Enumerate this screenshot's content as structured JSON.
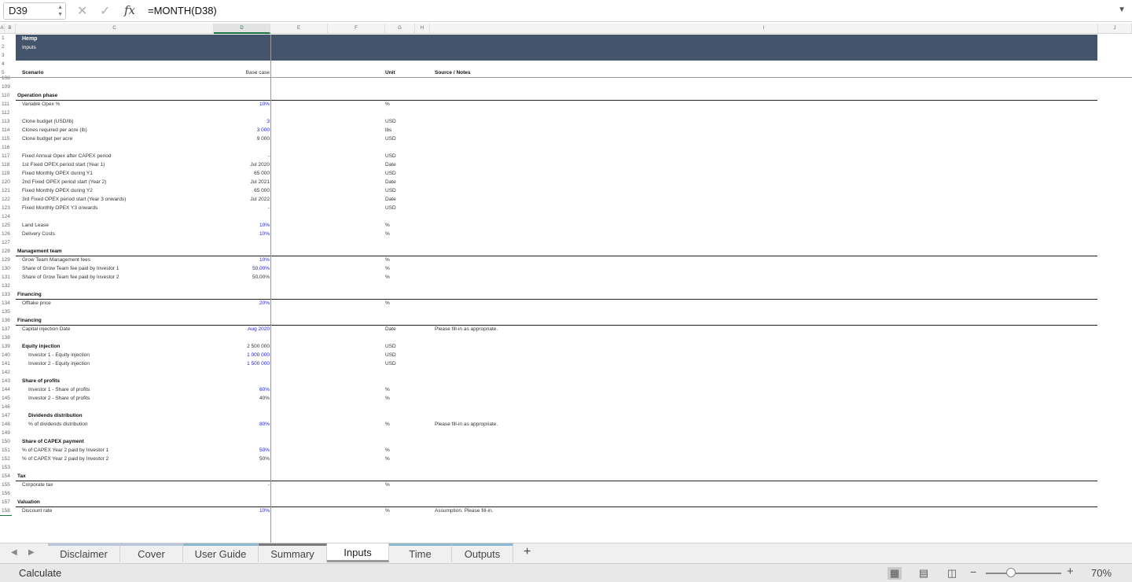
{
  "formula_bar": {
    "name_box": "D39",
    "fx_label": "fx",
    "cancel_icon": "x-icon",
    "enter_icon": "check-icon",
    "formula": "=MONTH(D38)"
  },
  "columns": [
    "A",
    "B",
    "C",
    "D",
    "E",
    "F",
    "G",
    "H",
    "I",
    "J"
  ],
  "banner": {
    "title": "Hemp",
    "subtitle": "Inputs"
  },
  "header_row": {
    "scenario": "Scenario",
    "base_case": "Base case",
    "unit": "Unit",
    "notes": "Source / Notes"
  },
  "top_row_numbers": [
    "1",
    "2",
    "3",
    "4",
    "5"
  ],
  "rows": [
    {
      "n": "108"
    },
    {
      "n": "109"
    },
    {
      "n": "110",
      "label": "Operation phase",
      "bold": true,
      "indent": 0,
      "line": true
    },
    {
      "n": "111",
      "label": "Variable Opex %",
      "value": "10%",
      "blue": true,
      "unit": "%"
    },
    {
      "n": "112"
    },
    {
      "n": "113",
      "label": "Clone budget (USD/lb)",
      "value": "3",
      "blue": true,
      "unit": "USD"
    },
    {
      "n": "114",
      "label": "Clones required per acre (lb)",
      "value": "3 000",
      "blue": true,
      "unit": "lbs"
    },
    {
      "n": "115",
      "label": "Clone budget per acre",
      "value": "9 000",
      "unit": "USD"
    },
    {
      "n": "116"
    },
    {
      "n": "117",
      "label": "Fixed Annual Opex after CAPEX period",
      "value": "-",
      "unit": "USD"
    },
    {
      "n": "118",
      "label": "1st Fixed OPEX period start (Year 1)",
      "value": "Jul 2020",
      "unit": "Date"
    },
    {
      "n": "119",
      "label": "Fixed Monthly OPEX during Y1",
      "value": "65 000",
      "unit": "USD"
    },
    {
      "n": "120",
      "label": "2nd Fixed OPEX period start (Year 2)",
      "value": "Jul 2021",
      "unit": "Date"
    },
    {
      "n": "121",
      "label": "Fixed Monthly OPEX during Y2",
      "value": "65 000",
      "unit": "USD"
    },
    {
      "n": "122",
      "label": "3rd Fixed OPEX period start (Year 3 onwards)",
      "value": "Jul 2022",
      "unit": "Date"
    },
    {
      "n": "123",
      "label": "Fixed Monthly OPEX Y3 onwards",
      "value": "-",
      "unit": "USD"
    },
    {
      "n": "124"
    },
    {
      "n": "125",
      "label": "Land Lease",
      "value": "10%",
      "blue": true,
      "unit": "%"
    },
    {
      "n": "126",
      "label": "Delivery Costs",
      "value": "10%",
      "blue": true,
      "unit": "%"
    },
    {
      "n": "127"
    },
    {
      "n": "128",
      "label": "Management team",
      "bold": true,
      "indent": 0,
      "line": true
    },
    {
      "n": "129",
      "label": "Grow Team Management fees",
      "value": "10%",
      "blue": true,
      "unit": "%"
    },
    {
      "n": "130",
      "label": "Share of Grow Team fee paid by Investor 1",
      "value": "50,00%",
      "blue": true,
      "unit": "%"
    },
    {
      "n": "131",
      "label": "Share of Grow Team fee paid by Investor 2",
      "value": "50,00%",
      "unit": "%"
    },
    {
      "n": "132"
    },
    {
      "n": "133",
      "label": "Financing",
      "bold": true,
      "indent": 0,
      "line": true
    },
    {
      "n": "134",
      "label": "Offtake price",
      "value": "20%",
      "blue": true,
      "unit": "%"
    },
    {
      "n": "135"
    },
    {
      "n": "136",
      "label": "Financing",
      "bold": true,
      "indent": 0,
      "line": true
    },
    {
      "n": "137",
      "label": "Capital injection Date",
      "value": "Aug 2020",
      "blue": true,
      "unit": "Date",
      "note": "Please fill-in as appropriate."
    },
    {
      "n": "138"
    },
    {
      "n": "139",
      "label": "Equity injection",
      "bold": true,
      "value": "2 500 000",
      "unit": "USD"
    },
    {
      "n": "140",
      "label": "Investor 1 - Equity injection",
      "indent": 2,
      "value": "1 000 000",
      "blue": true,
      "unit": "USD"
    },
    {
      "n": "141",
      "label": "Investor 2 - Equity injection",
      "indent": 2,
      "value": "1 500 000",
      "blue": true,
      "unit": "USD"
    },
    {
      "n": "142"
    },
    {
      "n": "143",
      "label": "Share of profits",
      "bold": true
    },
    {
      "n": "144",
      "label": "Investor 1 - Share of profits",
      "indent": 2,
      "value": "60%",
      "blue": true,
      "unit": "%"
    },
    {
      "n": "145",
      "label": "Investor 2 - Share of profits",
      "indent": 2,
      "value": "40%",
      "unit": "%"
    },
    {
      "n": "146"
    },
    {
      "n": "147",
      "label": "Dividends distribution",
      "bold": true,
      "indent": 2
    },
    {
      "n": "148",
      "label": "% of dividends distribution",
      "indent": 2,
      "value": "80%",
      "blue": true,
      "unit": "%",
      "note": "Please fill-in as appropriate."
    },
    {
      "n": "149"
    },
    {
      "n": "150",
      "label": "Share of CAPEX payment",
      "bold": true
    },
    {
      "n": "151",
      "label": "% of CAPEX Year 2 paid by Investor 1",
      "value": "50%",
      "blue": true,
      "unit": "%"
    },
    {
      "n": "152",
      "label": "% of CAPEX Year 2 paid by Investor 2",
      "value": "50%",
      "unit": "%"
    },
    {
      "n": "153"
    },
    {
      "n": "154",
      "label": "Tax",
      "bold": true,
      "indent": 0,
      "line": true
    },
    {
      "n": "155",
      "label": "Corporate tax",
      "value": "-",
      "unit": "%"
    },
    {
      "n": "156"
    },
    {
      "n": "157",
      "label": "Valuation",
      "bold": true,
      "indent": 0,
      "line": true
    },
    {
      "n": "158",
      "label": "Discount rate",
      "value": "10%",
      "blue": true,
      "unit": "%",
      "note": "Assumption. Please fill-in."
    }
  ],
  "tabs": [
    {
      "label": "Disclaimer"
    },
    {
      "label": "Cover"
    },
    {
      "label": "User Guide"
    },
    {
      "label": "Summary"
    },
    {
      "label": "Inputs",
      "active": true
    },
    {
      "label": "Time"
    },
    {
      "label": "Outputs"
    }
  ],
  "status": {
    "mode": "Calculate",
    "zoom": "70%",
    "zoom_level": 0.33,
    "view_icons": [
      "normal-view-icon",
      "page-layout-icon",
      "page-break-icon"
    ]
  }
}
